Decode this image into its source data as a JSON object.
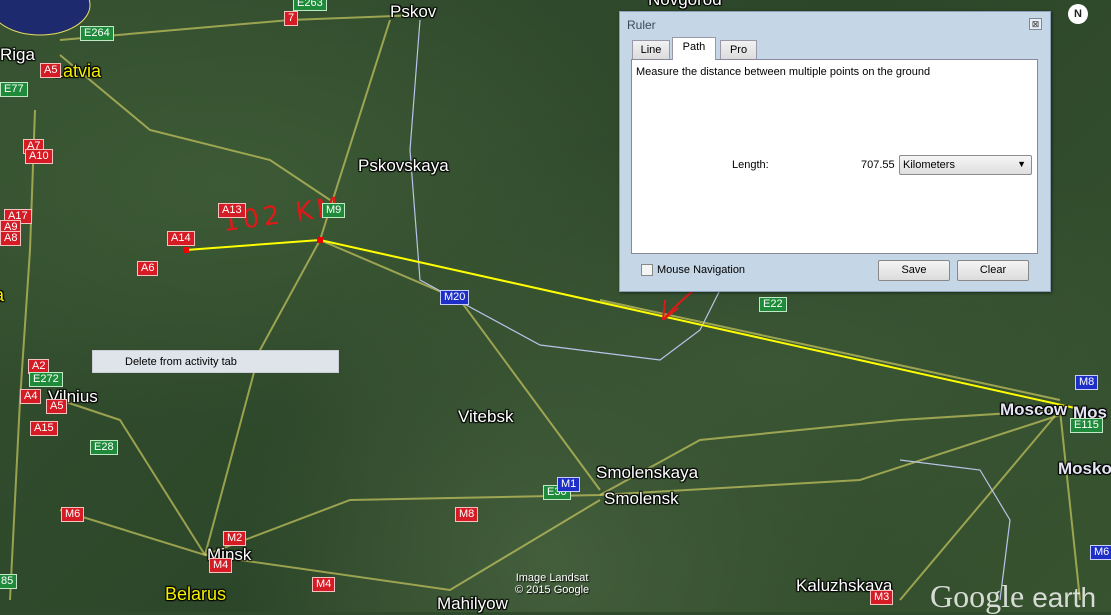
{
  "map": {
    "places": [
      "Riga",
      "Pskov",
      "Pskovskaya",
      "Vilnius",
      "Vitebsk",
      "Smolenskaya",
      "Smolensk",
      "Minsk",
      "Mahilyow",
      "Kaluzhskaya",
      "Moscow",
      "Mos",
      "Mosko",
      "Novgorod"
    ],
    "countries": [
      "Latvia",
      "Belarus",
      "a",
      "va"
    ],
    "shields": [
      "7",
      "A5",
      "A7",
      "A10",
      "A17",
      "A9",
      "A8",
      "A14",
      "A13",
      "A6",
      "A2",
      "A4",
      "A5",
      "A15",
      "M6",
      "M2",
      "M4",
      "M4",
      "M8",
      "M3",
      "E264",
      "E263",
      "E77",
      "M9",
      "E272",
      "E28",
      "E30",
      "E22",
      "E115",
      "85",
      "M20",
      "M1",
      "M8",
      "M6"
    ],
    "annotation": "102 KM",
    "credit_line1": "Image Landsat",
    "credit_line2": "© 2015 Google",
    "logo_google": "Google",
    "logo_earth": "earth",
    "compass": "N",
    "path_color": "#ffff00",
    "annotation_color": "#e01818"
  },
  "context_menu": {
    "item": "Delete from activity tab"
  },
  "ruler": {
    "title": "Ruler",
    "close": "⊠",
    "tabs": [
      "Line",
      "Path",
      "Pro"
    ],
    "active_tab": "Path",
    "description": "Measure the distance between multiple points on the ground",
    "length_label": "Length:",
    "length_value": "707.55",
    "unit": "Kilometers",
    "mouse_navigation": "Mouse Navigation",
    "mouse_navigation_checked": false,
    "save": "Save",
    "clear": "Clear"
  }
}
